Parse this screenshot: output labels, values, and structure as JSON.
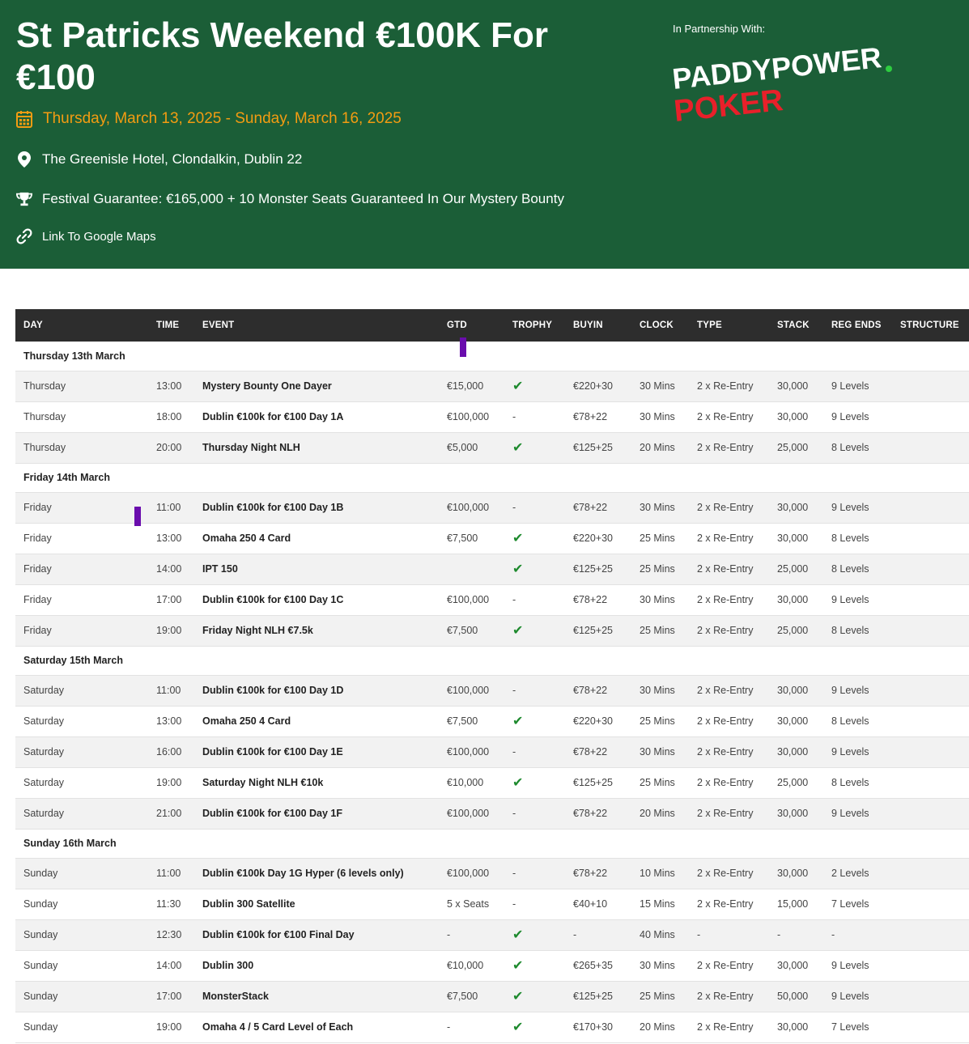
{
  "hero": {
    "title": "St Patricks Weekend €100K For €100",
    "date_range": "Thursday, March 13, 2025 - Sunday, March 16, 2025",
    "venue": "The Greenisle Hotel, Clondalkin, Dublin 22",
    "guarantee": "Festival Guarantee: €165,000 + 10 Monster Seats Guaranteed In Our Mystery Bounty",
    "map_link": "Link To Google Maps",
    "partner_label": "In Partnership With:",
    "logo_line1": "PADDYPOWER",
    "logo_line2": "POKER"
  },
  "colors": {
    "hero_bg": "#1b5e37",
    "date_accent": "#f39c12",
    "table_header_bg": "#2d2d2d",
    "check_green": "#1e8a2e",
    "logo_red": "#e8202a",
    "logo_dot": "#2ecc40",
    "marker": "#6a0dad"
  },
  "icons": {
    "date": "calendar-icon",
    "venue": "map-pin-icon",
    "guarantee": "trophy-icon",
    "map": "link-icon",
    "trophy_yes": "check-icon"
  },
  "table": {
    "headers": [
      "DAY",
      "TIME",
      "EVENT",
      "GTD",
      "TROPHY",
      "BUYIN",
      "CLOCK",
      "TYPE",
      "STACK",
      "REG ENDS",
      "STRUCTURE"
    ],
    "groups": [
      {
        "label": "Thursday 13th March",
        "rows": [
          {
            "day": "Thursday",
            "time": "13:00",
            "event": "Mystery Bounty One Dayer",
            "gtd": "€15,000",
            "trophy": true,
            "buyin": "€220+30",
            "clock": "30 Mins",
            "type": "2 x Re-Entry",
            "stack": "30,000",
            "reg_ends": "9 Levels"
          },
          {
            "day": "Thursday",
            "time": "18:00",
            "event": "Dublin €100k for €100 Day 1A",
            "gtd": "€100,000",
            "trophy": false,
            "buyin": "€78+22",
            "clock": "30 Mins",
            "type": "2 x Re-Entry",
            "stack": "30,000",
            "reg_ends": "9 Levels"
          },
          {
            "day": "Thursday",
            "time": "20:00",
            "event": "Thursday Night NLH",
            "gtd": "€5,000",
            "trophy": true,
            "buyin": "€125+25",
            "clock": "20 Mins",
            "type": "2 x Re-Entry",
            "stack": "25,000",
            "reg_ends": "8 Levels"
          }
        ]
      },
      {
        "label": "Friday 14th March",
        "rows": [
          {
            "day": "Friday",
            "time": "11:00",
            "event": "Dublin €100k for €100 Day 1B",
            "gtd": "€100,000",
            "trophy": false,
            "buyin": "€78+22",
            "clock": "30 Mins",
            "type": "2 x Re-Entry",
            "stack": "30,000",
            "reg_ends": "9 Levels"
          },
          {
            "day": "Friday",
            "time": "13:00",
            "event": "Omaha 250 4 Card",
            "gtd": "€7,500",
            "trophy": true,
            "buyin": "€220+30",
            "clock": "25 Mins",
            "type": "2 x Re-Entry",
            "stack": "30,000",
            "reg_ends": "8 Levels"
          },
          {
            "day": "Friday",
            "time": "14:00",
            "event": "IPT 150",
            "gtd": "",
            "trophy": true,
            "buyin": "€125+25",
            "clock": "25 Mins",
            "type": "2 x Re-Entry",
            "stack": "25,000",
            "reg_ends": "8 Levels"
          },
          {
            "day": "Friday",
            "time": "17:00",
            "event": "Dublin €100k for €100 Day 1C",
            "gtd": "€100,000",
            "trophy": false,
            "buyin": "€78+22",
            "clock": "30 Mins",
            "type": "2 x Re-Entry",
            "stack": "30,000",
            "reg_ends": "9 Levels"
          },
          {
            "day": "Friday",
            "time": "19:00",
            "event": "Friday Night NLH €7.5k",
            "gtd": "€7,500",
            "trophy": true,
            "buyin": "€125+25",
            "clock": "25 Mins",
            "type": "2 x Re-Entry",
            "stack": "25,000",
            "reg_ends": "8 Levels"
          }
        ]
      },
      {
        "label": "Saturday 15th March",
        "rows": [
          {
            "day": "Saturday",
            "time": "11:00",
            "event": "Dublin €100k for €100 Day 1D",
            "gtd": "€100,000",
            "trophy": false,
            "buyin": "€78+22",
            "clock": "30 Mins",
            "type": "2 x Re-Entry",
            "stack": "30,000",
            "reg_ends": "9 Levels"
          },
          {
            "day": "Saturday",
            "time": "13:00",
            "event": "Omaha 250 4 Card",
            "gtd": "€7,500",
            "trophy": true,
            "buyin": "€220+30",
            "clock": "25 Mins",
            "type": "2 x Re-Entry",
            "stack": "30,000",
            "reg_ends": "8 Levels"
          },
          {
            "day": "Saturday",
            "time": "16:00",
            "event": "Dublin €100k for €100 Day 1E",
            "gtd": "€100,000",
            "trophy": false,
            "buyin": "€78+22",
            "clock": "30 Mins",
            "type": "2 x Re-Entry",
            "stack": "30,000",
            "reg_ends": "9 Levels"
          },
          {
            "day": "Saturday",
            "time": "19:00",
            "event": "Saturday Night NLH €10k",
            "gtd": "€10,000",
            "trophy": true,
            "buyin": "€125+25",
            "clock": "25 Mins",
            "type": "2 x Re-Entry",
            "stack": "25,000",
            "reg_ends": "8 Levels"
          },
          {
            "day": "Saturday",
            "time": "21:00",
            "event": "Dublin €100k for €100 Day 1F",
            "gtd": "€100,000",
            "trophy": false,
            "buyin": "€78+22",
            "clock": "20 Mins",
            "type": "2 x Re-Entry",
            "stack": "30,000",
            "reg_ends": "9 Levels"
          }
        ]
      },
      {
        "label": "Sunday 16th March",
        "rows": [
          {
            "day": "Sunday",
            "time": "11:00",
            "event": "Dublin €100k Day 1G Hyper (6 levels only)",
            "gtd": "€100,000",
            "trophy": false,
            "buyin": "€78+22",
            "clock": "10 Mins",
            "type": "2 x Re-Entry",
            "stack": "30,000",
            "reg_ends": "2 Levels"
          },
          {
            "day": "Sunday",
            "time": "11:30",
            "event": "Dublin 300 Satellite",
            "gtd": "5 x Seats",
            "trophy": false,
            "buyin": "€40+10",
            "clock": "15 Mins",
            "type": "2 x Re-Entry",
            "stack": "15,000",
            "reg_ends": "7 Levels"
          },
          {
            "day": "Sunday",
            "time": "12:30",
            "event": "Dublin €100k for €100 Final Day",
            "gtd": "-",
            "trophy": true,
            "buyin": "-",
            "clock": "40 Mins",
            "type": "-",
            "stack": "-",
            "reg_ends": "-"
          },
          {
            "day": "Sunday",
            "time": "14:00",
            "event": "Dublin 300",
            "gtd": "€10,000",
            "trophy": true,
            "buyin": "€265+35",
            "clock": "30 Mins",
            "type": "2 x Re-Entry",
            "stack": "30,000",
            "reg_ends": "9 Levels"
          },
          {
            "day": "Sunday",
            "time": "17:00",
            "event": "MonsterStack",
            "gtd": "€7,500",
            "trophy": true,
            "buyin": "€125+25",
            "clock": "25 Mins",
            "type": "2 x Re-Entry",
            "stack": "50,000",
            "reg_ends": "9 Levels"
          },
          {
            "day": "Sunday",
            "time": "19:00",
            "event": "Omaha 4 / 5 Card Level of Each",
            "gtd": "-",
            "trophy": true,
            "buyin": "€170+30",
            "clock": "20 Mins",
            "type": "2 x Re-Entry",
            "stack": "30,000",
            "reg_ends": "7 Levels"
          }
        ]
      }
    ]
  }
}
